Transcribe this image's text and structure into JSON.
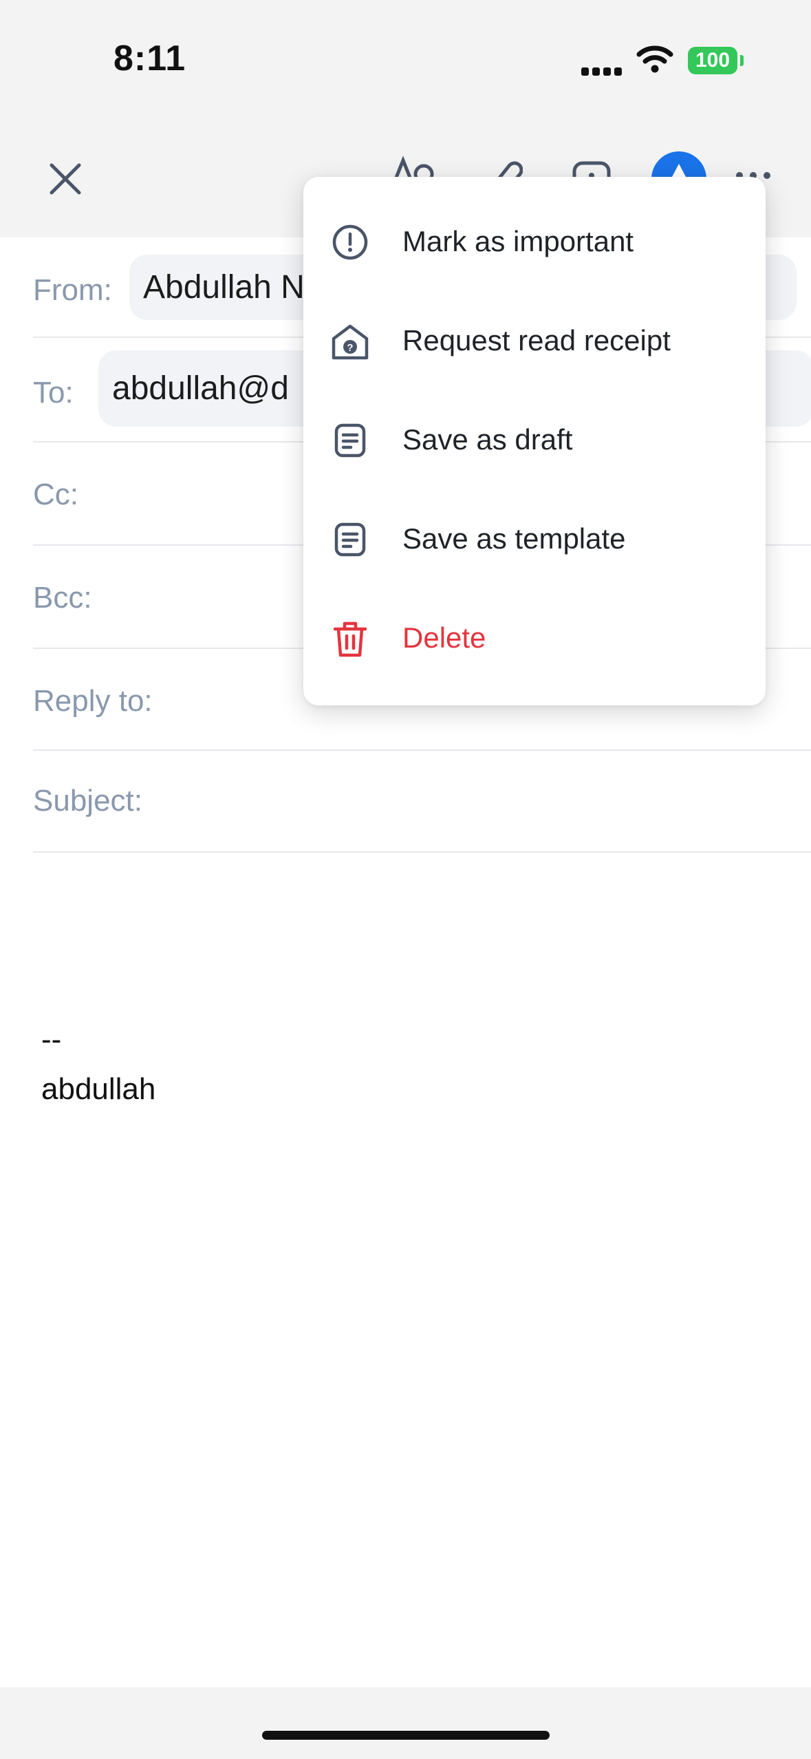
{
  "status_bar": {
    "time": "8:11",
    "battery": "100"
  },
  "compose": {
    "fields": {
      "from": {
        "label": "From:",
        "value": "Abdullah N"
      },
      "to": {
        "label": "To:",
        "value": "abdullah@d"
      },
      "cc": {
        "label": "Cc:"
      },
      "bcc": {
        "label": "Bcc:"
      },
      "reply_to": {
        "label": "Reply to:"
      },
      "subject": {
        "label": "Subject:"
      }
    },
    "signature": {
      "dashes": "--",
      "name": "abdullah"
    }
  },
  "toolbar": {
    "icons": [
      "close-icon",
      "text-format-icon",
      "attachment-icon",
      "image-icon",
      "send-icon",
      "more-icon"
    ],
    "send_color": "#1a73e8"
  },
  "menu": {
    "items": [
      {
        "label": "Mark as important",
        "icon": "exclamation-circle-icon"
      },
      {
        "label": "Request read receipt",
        "icon": "envelope-question-icon"
      },
      {
        "label": "Save as draft",
        "icon": "document-icon"
      },
      {
        "label": "Save as template",
        "icon": "document-icon"
      },
      {
        "label": "Delete",
        "icon": "trash-icon",
        "color": "#e5343d"
      }
    ]
  }
}
